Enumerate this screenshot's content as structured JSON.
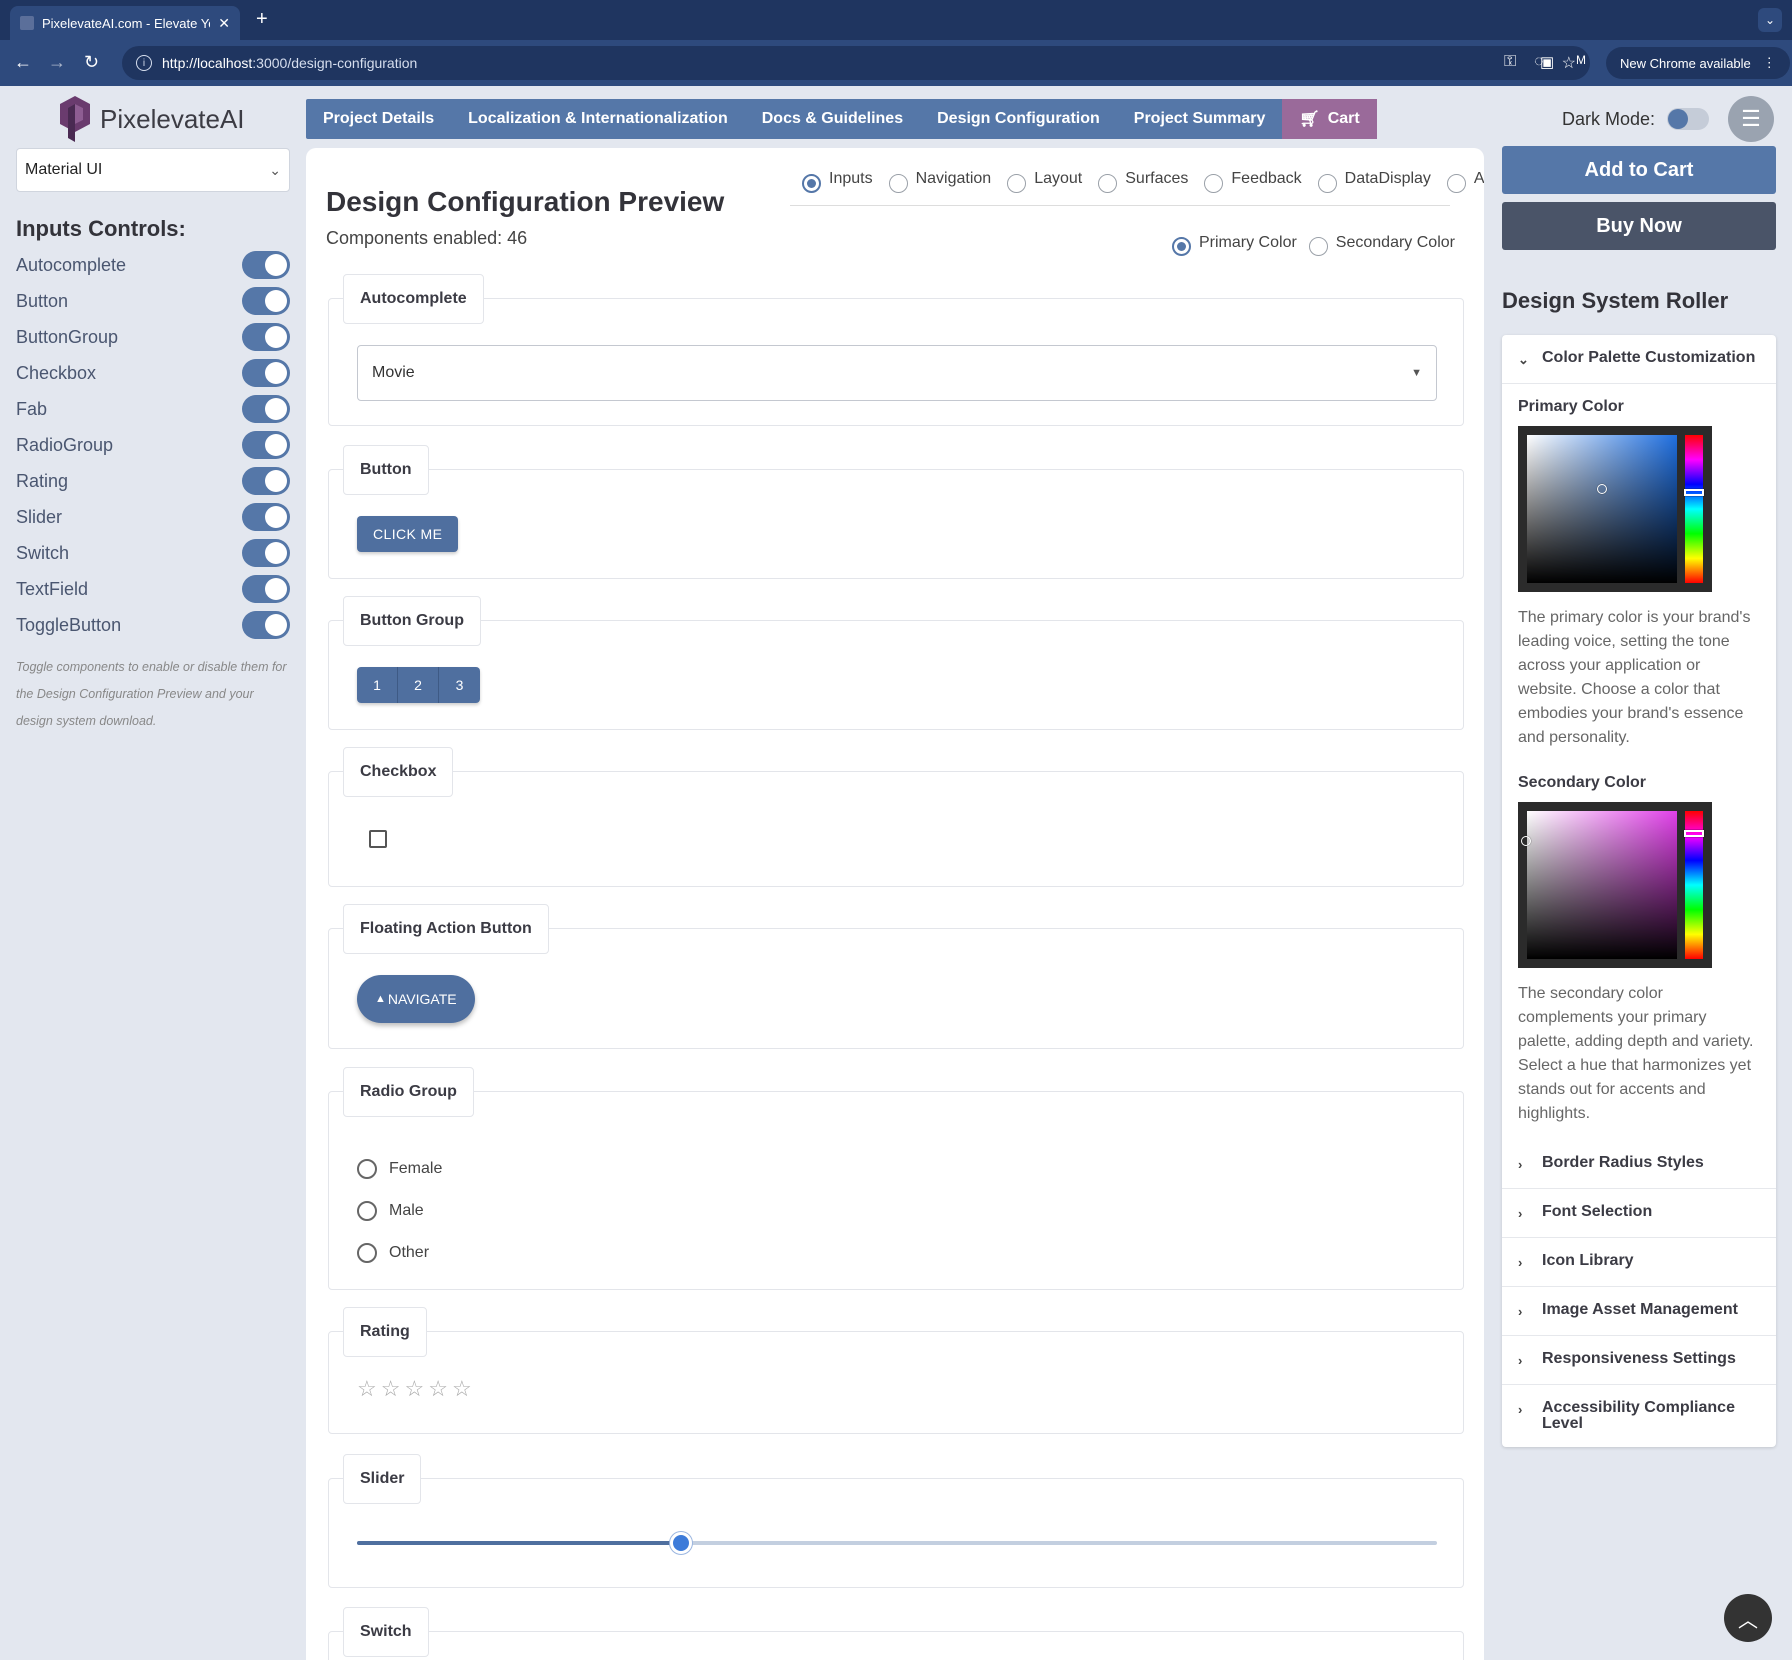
{
  "browser": {
    "tab_title": "PixelevateAI.com - Elevate Yo",
    "tab_close": "✕",
    "new_tab": "+",
    "tab_menu": "⌄",
    "url_host": "http://localhost",
    "url_path": ":3000/design-configuration",
    "profile_initial": "M",
    "chrome_notice": "New Chrome available",
    "menu_dots": "⋮"
  },
  "app": {
    "logo_text": "PixelevateAI",
    "nav": [
      {
        "label": "Project Details"
      },
      {
        "label": "Localization & Internationalization"
      },
      {
        "label": "Docs & Guidelines"
      },
      {
        "label": "Design Configuration"
      },
      {
        "label": "Project Summary"
      }
    ],
    "cart_label": "Cart",
    "dark_mode_label": "Dark Mode:",
    "dark_mode_on": false
  },
  "left_panel": {
    "library_selected": "Material UI",
    "controls_title": "Inputs Controls:",
    "controls": [
      {
        "label": "Autocomplete",
        "enabled": true
      },
      {
        "label": "Button",
        "enabled": true
      },
      {
        "label": "ButtonGroup",
        "enabled": true
      },
      {
        "label": "Checkbox",
        "enabled": true
      },
      {
        "label": "Fab",
        "enabled": true
      },
      {
        "label": "RadioGroup",
        "enabled": true
      },
      {
        "label": "Rating",
        "enabled": true
      },
      {
        "label": "Slider",
        "enabled": true
      },
      {
        "label": "Switch",
        "enabled": true
      },
      {
        "label": "TextField",
        "enabled": true
      },
      {
        "label": "ToggleButton",
        "enabled": true
      }
    ],
    "hint": "Toggle components to enable or disable them for the Design Configuration Preview and your design system download."
  },
  "preview": {
    "title": "Design Configuration Preview",
    "components_enabled": "Components enabled: 46",
    "categories": [
      "Inputs",
      "Navigation",
      "Layout",
      "Surfaces",
      "Feedback",
      "DataDisplay",
      "All"
    ],
    "selected_category": "Inputs",
    "color_options": [
      "Primary Color",
      "Secondary Color"
    ],
    "selected_color": "Primary Color",
    "sections": {
      "autocomplete": {
        "label": "Autocomplete",
        "value": "Movie"
      },
      "button": {
        "label": "Button",
        "button_text": "CLICK ME"
      },
      "button_group": {
        "label": "Button Group",
        "buttons": [
          "1",
          "2",
          "3"
        ]
      },
      "checkbox": {
        "label": "Checkbox",
        "checked": false
      },
      "fab": {
        "label": "Floating Action Button",
        "icon": "▲",
        "text": "NAVIGATE"
      },
      "radio_group": {
        "label": "Radio Group",
        "options": [
          "Female",
          "Male",
          "Other"
        ]
      },
      "rating": {
        "label": "Rating",
        "stars": [
          "☆",
          "☆",
          "☆",
          "☆",
          "☆"
        ],
        "value": 0
      },
      "slider": {
        "label": "Slider",
        "value_percent": 30
      },
      "switch": {
        "label": "Switch"
      }
    }
  },
  "right_panel": {
    "add_to_cart": "Add to Cart",
    "buy_now": "Buy Now",
    "title": "Design System Roller",
    "color_palette": {
      "heading": "Color Palette Customization",
      "primary_label": "Primary Color",
      "primary_text": "The primary color is your brand's leading voice, setting the tone across your application or website. Choose a color that embodies your brand's essence and personality.",
      "secondary_label": "Secondary Color",
      "secondary_text": "The secondary color complements your primary palette, adding depth and variety. Select a hue that harmonizes yet stands out for accents and highlights.",
      "primary_hue_color": "#1f6fe0",
      "secondary_hue_color": "#e040e8"
    },
    "sections": [
      {
        "label": "Border Radius Styles"
      },
      {
        "label": "Font Selection"
      },
      {
        "label": "Icon Library"
      },
      {
        "label": "Image Asset Management"
      },
      {
        "label": "Responsiveness Settings"
      },
      {
        "label": "Accessibility Compliance Level"
      }
    ]
  },
  "colors": {
    "accent": "#5577a8",
    "cart": "#9a6a9a",
    "add_to_cart": "#5577a8",
    "buy_now": "#4a5468"
  }
}
